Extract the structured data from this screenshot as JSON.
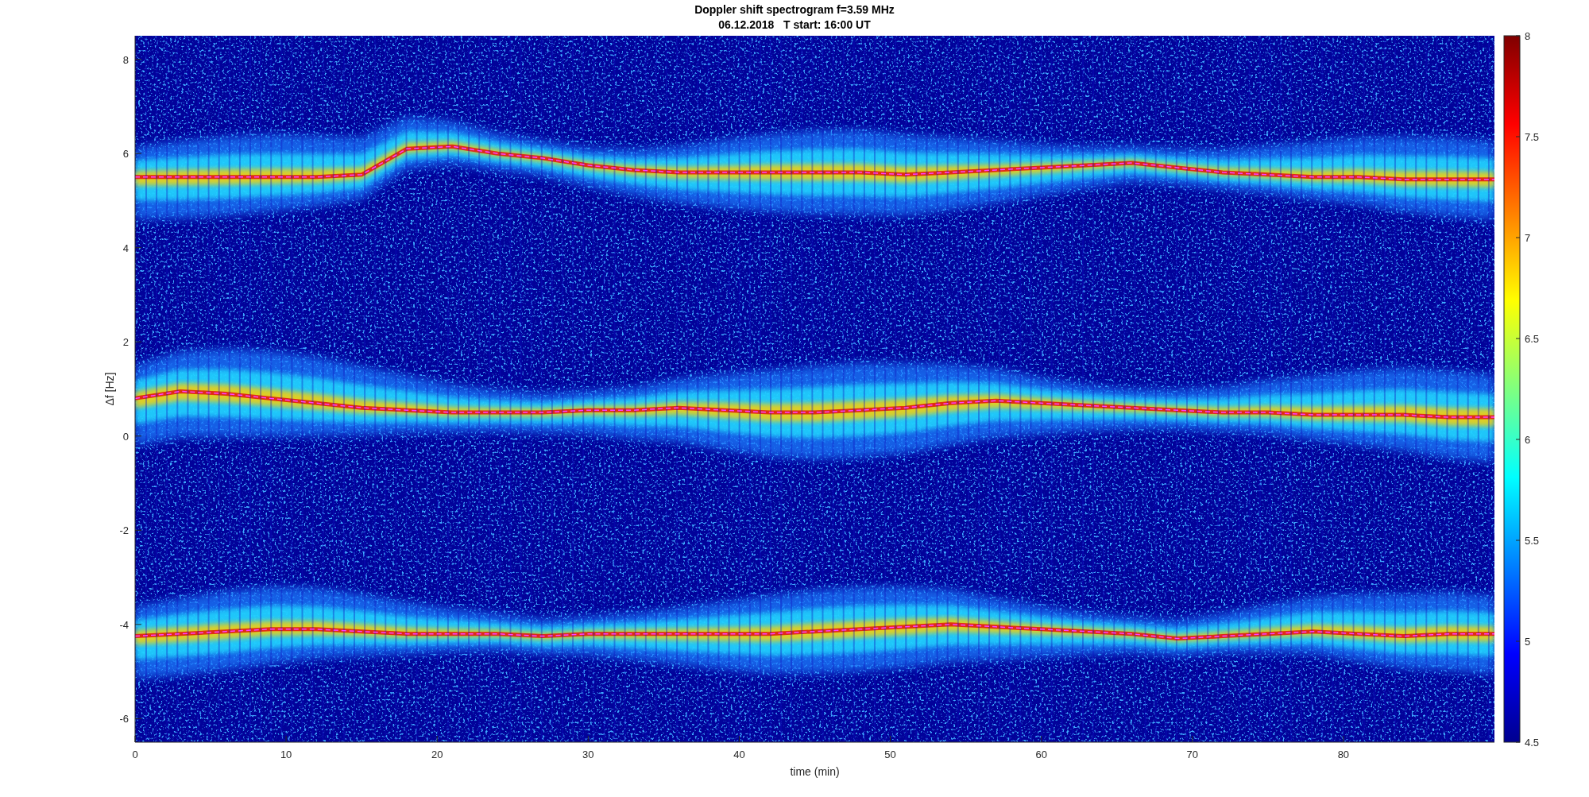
{
  "title": [
    "Doppler shift spectrogram f=3.59 MHz",
    "06.12.2018   T start: 16:00 UT"
  ],
  "axes": {
    "xlabel": "time (min)",
    "ylabel": "Δf [Hz]",
    "xticks": [
      "0",
      "10",
      "20",
      "30",
      "40",
      "50",
      "60",
      "70",
      "80"
    ],
    "yticks": [
      "8",
      "6",
      "4",
      "2",
      "0",
      "-2",
      "-4",
      "-6"
    ]
  },
  "colorbar": {
    "ticks": [
      "8",
      "7.5",
      "7",
      "6.5",
      "6",
      "5.5",
      "5",
      "4.5"
    ]
  }
}
